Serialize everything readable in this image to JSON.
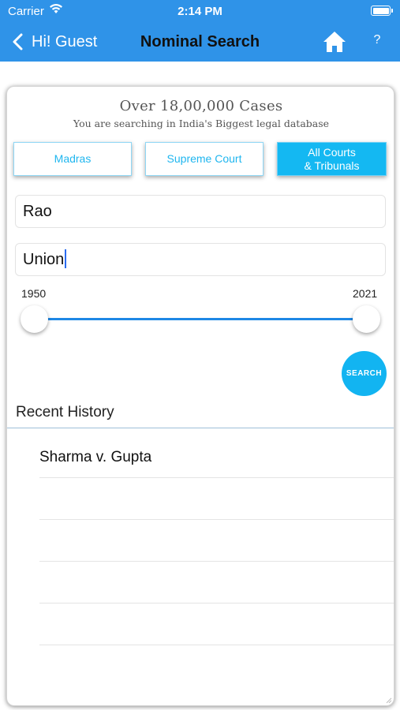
{
  "status": {
    "carrier": "Carrier",
    "time": "2:14 PM"
  },
  "nav": {
    "back_label": "Hi! Guest",
    "title": "Nominal Search",
    "help_label": "?"
  },
  "header": {
    "headline": "Over 18,00,000 Cases",
    "subline": "You are searching in India's Biggest legal database"
  },
  "courts": [
    {
      "line1": "Madras",
      "line2": "",
      "selected": false
    },
    {
      "line1": "Supreme Court",
      "line2": "",
      "selected": false
    },
    {
      "line1": "All Courts",
      "line2": "& Tribunals",
      "selected": true
    }
  ],
  "form": {
    "party1_value": "Rao",
    "party2_value": "Union"
  },
  "year_range": {
    "min_label": "1950",
    "max_label": "2021"
  },
  "search_button": "SEARCH",
  "recent": {
    "title": "Recent History",
    "items": [
      "Sharma v. Gupta",
      "",
      "",
      "",
      ""
    ]
  },
  "colors": {
    "nav_bg": "#2f93e8",
    "accent": "#14b8f2",
    "slider": "#1e88e5"
  }
}
